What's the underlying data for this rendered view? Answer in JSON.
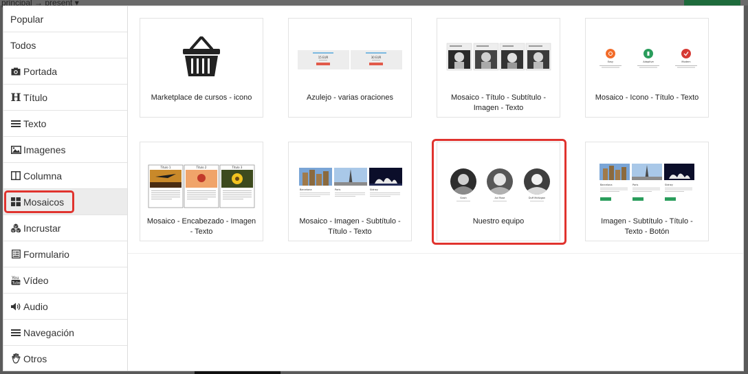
{
  "backdrop": {
    "top_text": "principal → present ▾"
  },
  "categories": [
    {
      "label": "Popular",
      "icon": "none"
    },
    {
      "label": "Todos",
      "icon": "none"
    },
    {
      "label": "Portada",
      "icon": "camera-icon"
    },
    {
      "label": "Título",
      "icon": "heading-icon"
    },
    {
      "label": "Texto",
      "icon": "align-justify-icon"
    },
    {
      "label": "Imagenes",
      "icon": "image-icon"
    },
    {
      "label": "Columna",
      "icon": "columns-icon"
    },
    {
      "label": "Mosaicos",
      "icon": "grid-icon"
    },
    {
      "label": "Incrustar",
      "icon": "cubes-icon"
    },
    {
      "label": "Formulario",
      "icon": "form-icon"
    },
    {
      "label": "Vídeo",
      "icon": "youtube-icon"
    },
    {
      "label": "Audio",
      "icon": "volume-icon"
    },
    {
      "label": "Navegación",
      "icon": "bars-icon"
    },
    {
      "label": "Otros",
      "icon": "hand-icon"
    }
  ],
  "active_category": "Mosaicos",
  "blocks": [
    {
      "label": "Marketplace de cursos - icono",
      "preview": "basket-icon"
    },
    {
      "label": "Azulejo - varias oraciones",
      "preview": "pricing-tiles",
      "price_a": "15 EUR",
      "price_b": "30 EUR"
    },
    {
      "label": "Mosaico - Título - Subtítulo - Imagen - Texto",
      "preview": "portrait-row"
    },
    {
      "label": "Mosaico - Icono - Título - Texto",
      "preview": "icon-row",
      "items": [
        "Easy",
        "Adaptive",
        "Modern"
      ]
    },
    {
      "label": "Mosaico - Encabezado - Imagen - Texto",
      "preview": "framed-tiles",
      "items": [
        "Titulo 1",
        "Titulo 2",
        "Titulo 3"
      ]
    },
    {
      "label": "Mosaico - Imagen - Subtítulo - Título - Texto",
      "preview": "city-row",
      "items": [
        "Barcelona",
        "Paris",
        "Sidney"
      ]
    },
    {
      "label": "Nuestro equipo",
      "preview": "team-row",
      "items": [
        "Slash",
        "Axl Rose",
        "Duff McKagan"
      ]
    },
    {
      "label": "Imagen - Subtítulo - Título - Texto - Botón",
      "preview": "city-button-row",
      "items": [
        "Barcelona",
        "Paris",
        "Sidney"
      ]
    }
  ],
  "highlighted_block": "Nuestro equipo",
  "colors": {
    "highlight": "#e0332e",
    "accent_green": "#2a9d5c",
    "accent_orange": "#f26c2a",
    "accent_red": "#d63a34"
  }
}
